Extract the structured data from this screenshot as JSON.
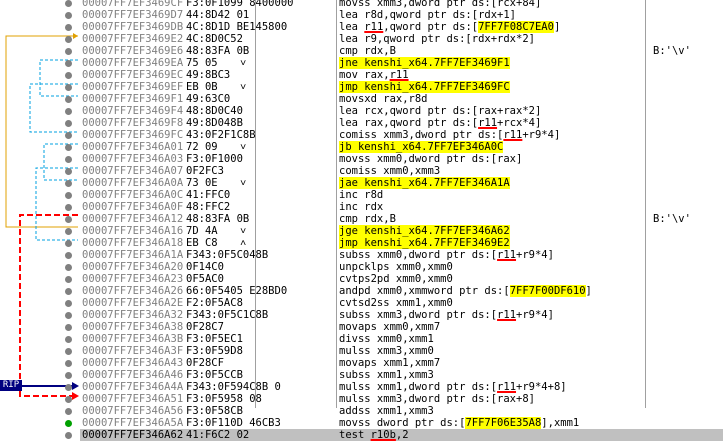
{
  "rip_label": "RIP",
  "colors": {
    "highlight": "#ffff00",
    "current_row": "#c0c0c0",
    "jump_taken": "#ff0000",
    "jump_line": "#00a0e0",
    "loop_line": "#e0a000"
  },
  "rows": [
    {
      "addr": "00007FF7EF3469CF",
      "arrow": "",
      "bytes": "F3:0F1099 8400000",
      "instr": "movss xmm3,dword ptr ds:[rcx+84]",
      "comment": ""
    },
    {
      "addr": "00007FF7EF3469D7",
      "arrow": "",
      "bytes": "44:8D42 01",
      "instr": "lea r8d,qword ptr ds:[rdx+1]",
      "comment": ""
    },
    {
      "addr": "00007FF7EF3469DB",
      "arrow": "",
      "bytes": "4C:8D1D BE145800",
      "instr": "lea r11,qword ptr ds:[7FF7F08C7EA0]",
      "comment": ""
    },
    {
      "addr": "00007FF7EF3469E2",
      "arrow": "",
      "bytes": "4C:8D0C52",
      "instr": "lea r9,qword ptr ds:[rdx+rdx*2]",
      "comment": ""
    },
    {
      "addr": "00007FF7EF3469E6",
      "arrow": "",
      "bytes": "48:83FA 0B",
      "instr": "cmp rdx,B",
      "comment": "B:'\\v'"
    },
    {
      "addr": "00007FF7EF3469EA",
      "arrow": "v",
      "bytes": "75 05",
      "instr": "jne kenshi_x64.7FF7EF3469F1",
      "comment": ""
    },
    {
      "addr": "00007FF7EF3469EC",
      "arrow": "",
      "bytes": "49:8BC3",
      "instr": "mov rax,r11",
      "comment": ""
    },
    {
      "addr": "00007FF7EF3469EF",
      "arrow": "v",
      "bytes": "EB 0B",
      "instr": "jmp kenshi_x64.7FF7EF3469FC",
      "comment": ""
    },
    {
      "addr": "00007FF7EF3469F1",
      "arrow": "",
      "bytes": "49:63C0",
      "instr": "movsxd rax,r8d",
      "comment": ""
    },
    {
      "addr": "00007FF7EF3469F4",
      "arrow": "",
      "bytes": "48:8D0C40",
      "instr": "lea rcx,qword ptr ds:[rax+rax*2]",
      "comment": ""
    },
    {
      "addr": "00007FF7EF3469F8",
      "arrow": "",
      "bytes": "49:8D048B",
      "instr": "lea rax,qword ptr ds:[r11+rcx*4]",
      "comment": ""
    },
    {
      "addr": "00007FF7EF3469FC",
      "arrow": "",
      "bytes": "43:0F2F1C8B",
      "instr": "comiss xmm3,dword ptr ds:[r11+r9*4]",
      "comment": ""
    },
    {
      "addr": "00007FF7EF346A01",
      "arrow": "v",
      "bytes": "72 09",
      "instr": "jb kenshi_x64.7FF7EF346A0C",
      "comment": ""
    },
    {
      "addr": "00007FF7EF346A03",
      "arrow": "",
      "bytes": "F3:0F1000",
      "instr": "movss xmm0,dword ptr ds:[rax]",
      "comment": ""
    },
    {
      "addr": "00007FF7EF346A07",
      "arrow": "",
      "bytes": "0F2FC3",
      "instr": "comiss xmm0,xmm3",
      "comment": ""
    },
    {
      "addr": "00007FF7EF346A0A",
      "arrow": "v",
      "bytes": "73 0E",
      "instr": "jae kenshi_x64.7FF7EF346A1A",
      "comment": ""
    },
    {
      "addr": "00007FF7EF346A0C",
      "arrow": "",
      "bytes": "41:FFC0",
      "instr": "inc r8d",
      "comment": ""
    },
    {
      "addr": "00007FF7EF346A0F",
      "arrow": "",
      "bytes": "48:FFC2",
      "instr": "inc rdx",
      "comment": ""
    },
    {
      "addr": "00007FF7EF346A12",
      "arrow": "",
      "bytes": "48:83FA 0B",
      "instr": "cmp rdx,B",
      "comment": "B:'\\v'"
    },
    {
      "addr": "00007FF7EF346A16",
      "arrow": "v",
      "bytes": "7D 4A",
      "instr": "jge kenshi_x64.7FF7EF346A62",
      "comment": ""
    },
    {
      "addr": "00007FF7EF346A18",
      "arrow": "^",
      "bytes": "EB C8",
      "instr": "jmp kenshi_x64.7FF7EF3469E2",
      "comment": ""
    },
    {
      "addr": "00007FF7EF346A1A",
      "arrow": "",
      "bytes": "F343:0F5C048B",
      "instr": "subss xmm0,dword ptr ds:[r11+r9*4]",
      "comment": ""
    },
    {
      "addr": "00007FF7EF346A20",
      "arrow": "",
      "bytes": "0F14C0",
      "instr": "unpcklps xmm0,xmm0",
      "comment": ""
    },
    {
      "addr": "00007FF7EF346A23",
      "arrow": "",
      "bytes": "0F5AC0",
      "instr": "cvtps2pd xmm0,xmm0",
      "comment": ""
    },
    {
      "addr": "00007FF7EF346A26",
      "arrow": "",
      "bytes": "66:0F5405 E28BD0",
      "instr": "andpd xmm0,xmmword ptr ds:[7FF7F00DF610]",
      "comment": ""
    },
    {
      "addr": "00007FF7EF346A2E",
      "arrow": "",
      "bytes": "F2:0F5AC8",
      "instr": "cvtsd2ss xmm1,xmm0",
      "comment": ""
    },
    {
      "addr": "00007FF7EF346A32",
      "arrow": "",
      "bytes": "F343:0F5C1C8B",
      "instr": "subss xmm3,dword ptr ds:[r11+r9*4]",
      "comment": ""
    },
    {
      "addr": "00007FF7EF346A38",
      "arrow": "",
      "bytes": "0F28C7",
      "instr": "movaps xmm0,xmm7",
      "comment": ""
    },
    {
      "addr": "00007FF7EF346A3B",
      "arrow": "",
      "bytes": "F3:0F5EC1",
      "instr": "divss xmm0,xmm1",
      "comment": ""
    },
    {
      "addr": "00007FF7EF346A3F",
      "arrow": "",
      "bytes": "F3:0F59D8",
      "instr": "mulss xmm3,xmm0",
      "comment": ""
    },
    {
      "addr": "00007FF7EF346A43",
      "arrow": "",
      "bytes": "0F28CF",
      "instr": "movaps xmm1,xmm7",
      "comment": ""
    },
    {
      "addr": "00007FF7EF346A46",
      "arrow": "",
      "bytes": "F3:0F5CCB",
      "instr": "subss xmm1,xmm3",
      "comment": ""
    },
    {
      "addr": "00007FF7EF346A4A",
      "arrow": "",
      "bytes": "F343:0F594C8B 0",
      "instr": "mulss xmm1,dword ptr ds:[r11+r9*4+8]",
      "comment": ""
    },
    {
      "addr": "00007FF7EF346A51",
      "arrow": "",
      "bytes": "F3:0F5958 08",
      "instr": "mulss xmm3,dword ptr ds:[rax+8]",
      "comment": ""
    },
    {
      "addr": "00007FF7EF346A56",
      "arrow": "",
      "bytes": "F3:0F58CB",
      "instr": "addss xmm1,xmm3",
      "comment": ""
    },
    {
      "addr": "00007FF7EF346A5A",
      "arrow": "",
      "bytes": "F3:0F110D 46CB3",
      "instr": "movss dword ptr ds:[7FF7F06E35A8],xmm1",
      "comment": ""
    },
    {
      "addr": "00007FF7EF346A62",
      "arrow": "",
      "bytes": "41:F6C2 02",
      "instr": "test r10b,2",
      "comment": ""
    }
  ]
}
